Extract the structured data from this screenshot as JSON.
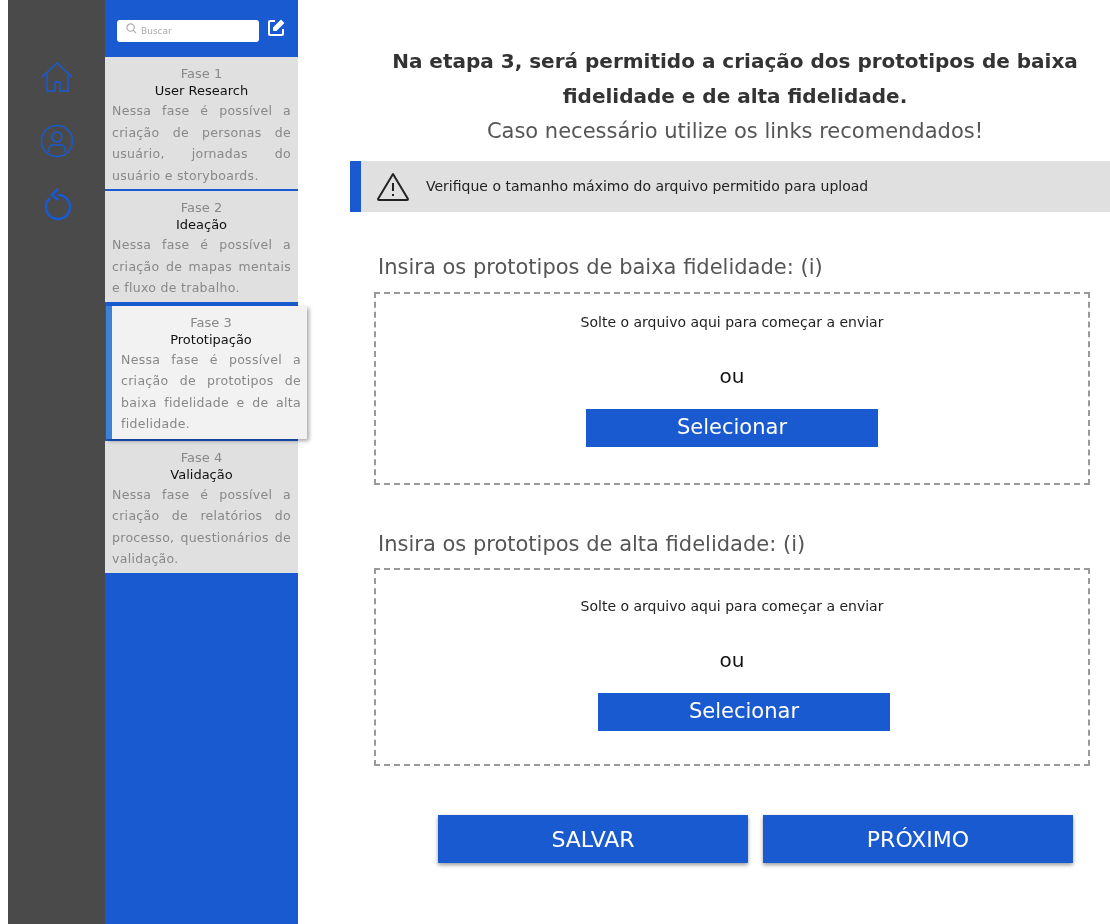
{
  "rail": {
    "items": [
      {
        "kind": "home"
      },
      {
        "kind": "user"
      },
      {
        "kind": "undo"
      }
    ]
  },
  "sidebar": {
    "search": {
      "placeholder": "Buscar"
    },
    "phases": [
      {
        "phase": "Fase 1",
        "title": "User Research",
        "description": "Nessa fase é possível a criação de personas de usuário, jornadas do usuário e storyboards.",
        "selected": false
      },
      {
        "phase": "Fase 2",
        "title": "Ideação",
        "description": "Nessa fase é possível a criação de mapas mentais e fluxo de trabalho.",
        "selected": false
      },
      {
        "phase": "Fase 3",
        "title": "Prototipação",
        "description": "Nessa fase é possível a criação de prototipos de baixa fidelidade e de alta fidelidade.",
        "selected": true
      },
      {
        "phase": "Fase 4",
        "title": "Validação",
        "description": "Nessa fase é possível a criação de relatórios do processo, questionários de validação.",
        "selected": false
      }
    ]
  },
  "main": {
    "heading": "Na etapa 3, será permitido a criação dos prototipos de baixa fidelidade e de alta fidelidade.",
    "subheading": "Caso necessário utilize os links recomendados!",
    "alert": "Verifique o tamanho máximo do arquivo permitido para upload",
    "uploads": [
      {
        "label": "Insira os prototipos de baixa fidelidade: (i)",
        "drop_text": "Solte o arquivo aqui para começar a enviar",
        "or": "ou",
        "button": "Selecionar"
      },
      {
        "label": "Insira os prototipos de alta fidelidade: (i)",
        "drop_text": "Solte o arquivo aqui para começar a enviar",
        "or": "ou",
        "button": "Selecionar"
      }
    ],
    "buttons": [
      "SALVAR",
      "PRÓXIMO"
    ]
  }
}
